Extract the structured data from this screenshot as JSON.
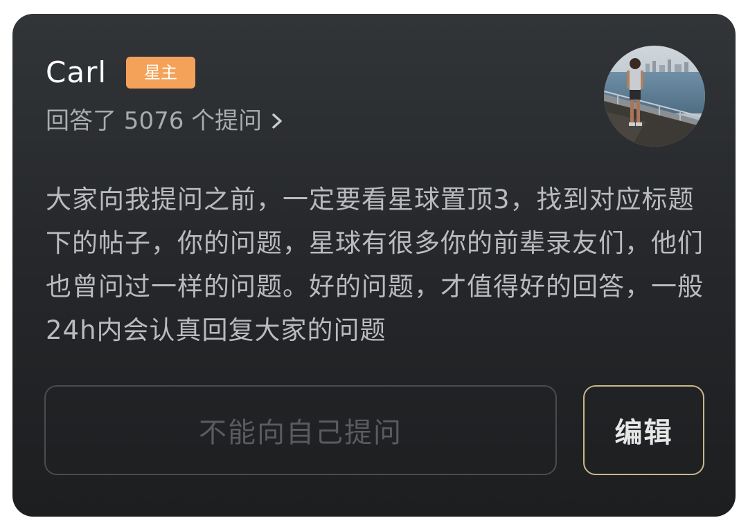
{
  "profile": {
    "name": "Carl",
    "badge": "星主",
    "answered_text": "回答了 5076 个提问"
  },
  "description": "大家向我提问之前，一定要看星球置顶3，找到对应标题下的帖子，你的问题，星球有很多你的前辈录友们，他们也曾问过一样的问题。好的问题，才值得好的回答，一般24h内会认真回复大家的问题",
  "actions": {
    "ask_disabled_label": "不能向自己提问",
    "edit_label": "编辑"
  },
  "colors": {
    "badge": "#f4a259",
    "edit_border": "#c9b98a",
    "card_bg": "#26282b"
  },
  "icons": {
    "answered_link": "chevron-right-icon"
  }
}
